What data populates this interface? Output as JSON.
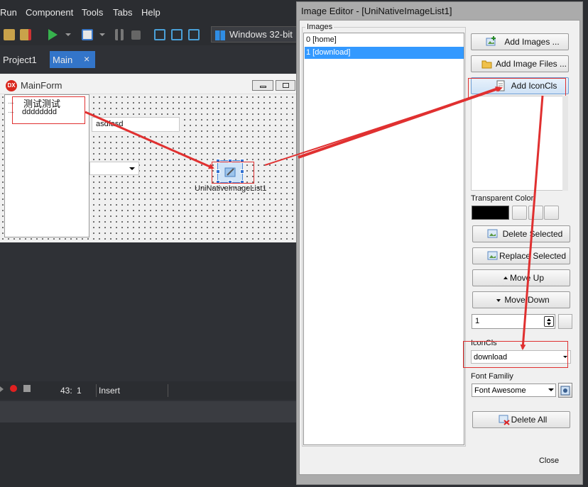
{
  "ide": {
    "menu": [
      "Run",
      "Component",
      "Tools",
      "Tabs",
      "Help"
    ],
    "platform": "Windows 32-bit",
    "tabs": [
      "Project1",
      "Main"
    ],
    "tab_close_glyph": "×",
    "status": {
      "line": "43:",
      "col": "1",
      "mode": "Insert"
    }
  },
  "designer": {
    "form_title": "MainForm",
    "logo_text": "DX",
    "tree_nodes": [
      "测试测试",
      "dddddddd"
    ],
    "edit_value": "asdfasd",
    "component_label": "UniNativeImageList1"
  },
  "dialog": {
    "title": "Image Editor - [UniNativeImageList1]",
    "images_group": "Images",
    "images": [
      "0 [home]",
      "1 [download]"
    ],
    "selected_index": 1,
    "buttons": {
      "add_images": "Add Images ...",
      "add_image_files": "Add Image Files ...",
      "add_iconcls": "Add IconCls",
      "delete_selected": "Delete Selected",
      "replace_selected": "Replace Selected",
      "move_up": "Move Up",
      "move_down": "Move Down",
      "delete_all": "Delete All",
      "close": "Close"
    },
    "transparent_color_label": "Transparent Color",
    "transparent_color": "#000000",
    "spin_value": "1",
    "iconcls_label": "IconCls",
    "iconcls_value": "download",
    "font_family_label": "Font Familiy",
    "font_family_value": "Font Awesome"
  },
  "colors": {
    "annotation": "#e03030",
    "selection": "#3399ff",
    "active_tab": "#3375c9"
  }
}
